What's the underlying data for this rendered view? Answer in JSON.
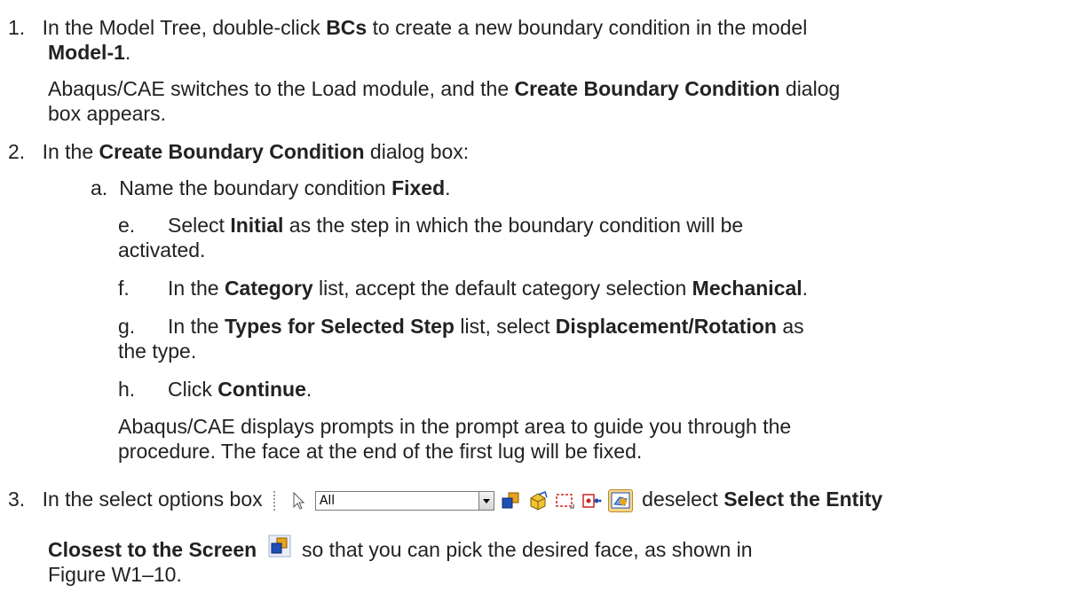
{
  "steps": {
    "s1": {
      "num": "1.",
      "line1": {
        "a": "In the Model Tree, double-click ",
        "b": "BCs",
        "c": " to create a new boundary condition in the model"
      },
      "line2": {
        "b": "Model-1",
        "c": "."
      },
      "line3": {
        "a": "Abaqus/CAE switches to the Load module, and the ",
        "b": "Create Boundary Condition",
        "c": " dialog"
      },
      "line4": "box appears."
    },
    "s2": {
      "num": "2.",
      "intro": {
        "a": "In the ",
        "b": "Create Boundary Condition",
        "c": " dialog box:"
      },
      "a": {
        "num": "a.",
        "t1": "Name the boundary condition ",
        "b": "Fixed",
        "t2": "."
      },
      "e": {
        "num": "e.",
        "t1": "Select ",
        "b": "Initial",
        "t2": " as the step in which the boundary condition will be",
        "cont": "activated."
      },
      "f": {
        "num": "f.",
        "t1": "In the ",
        "b1": "Category",
        "t2": " list, accept the default category selection ",
        "b2": "Mechanical",
        "t3": "."
      },
      "g": {
        "num": "g.",
        "t1": "In the ",
        "b1": "Types for Selected Step",
        "t2": " list, select ",
        "b2": "Displacement/Rotation",
        "t3": " as",
        "cont": "the type."
      },
      "h": {
        "num": "h.",
        "t1": "Click ",
        "b": "Continue",
        "t2": "."
      },
      "note1": "Abaqus/CAE displays prompts in the prompt area to guide you through the",
      "note2": "procedure. The face at the end of the first lug will be fixed."
    },
    "s3": {
      "num": "3.",
      "t1": "In the select options box",
      "dropdown_value": "All",
      "t2": "deselect ",
      "b1": "Select the Entity",
      "b2": "Closest to the Screen",
      "t3": " so that you can pick the desired face, as shown in",
      "t4": "Figure W1–10."
    }
  },
  "colors": {
    "text": "#222222",
    "accent_blue": "#1f4fb5",
    "accent_orange": "#e8a21c"
  }
}
